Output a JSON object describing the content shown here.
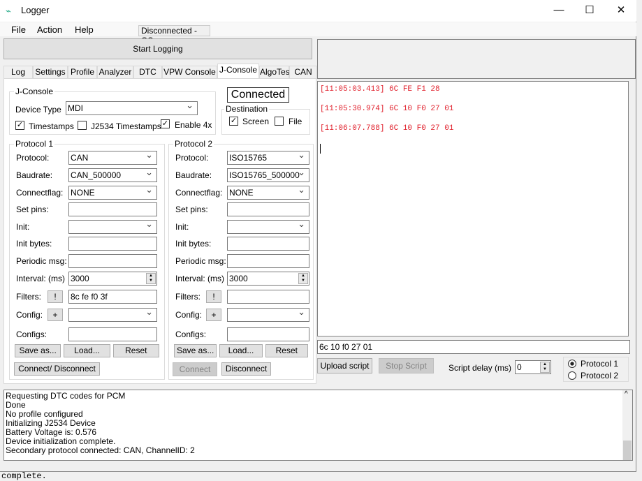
{
  "window": {
    "title": "Logger",
    "minimize": "—",
    "maximize": "☐",
    "close": "✕"
  },
  "menu": {
    "items": [
      "File",
      "Action",
      "Help"
    ],
    "status": "Disconnected - OS:"
  },
  "start_logging": "Start Logging",
  "tabs": [
    "Log",
    "Settings",
    "Profile",
    "Analyzer",
    "DTC",
    "VPW Console",
    "J-Console",
    "AlgoTest",
    "CAN"
  ],
  "selected_tab": "J-Console",
  "jconsole": {
    "group": "J-Console",
    "device_type_label": "Device Type",
    "device_type": "MDI",
    "timestamps": {
      "label": "Timestamps",
      "checked": true
    },
    "j2534_timestamps": {
      "label": "J2534 Timestamps",
      "checked": false
    },
    "enable4x": {
      "label": "Enable 4x",
      "checked": true
    }
  },
  "connection_status": "Connected",
  "destination": {
    "label": "Destination",
    "screen": {
      "label": "Screen",
      "checked": true
    },
    "file": {
      "label": "File",
      "checked": false
    }
  },
  "labels": {
    "protocol": "Protocol:",
    "baudrate": "Baudrate:",
    "connectflag": "Connectflag:",
    "set_pins": "Set pins:",
    "init": "Init:",
    "init_bytes": "Init bytes:",
    "periodic_msg": "Periodic msg:",
    "interval": "Interval: (ms)",
    "filters": "Filters:",
    "config": "Config:",
    "configs": "Configs:",
    "filter_btn": "!",
    "config_btn": "+",
    "save_as": "Save as...",
    "load": "Load...",
    "reset": "Reset"
  },
  "protocol1": {
    "title": "Protocol 1",
    "protocol": "CAN",
    "baudrate": "CAN_500000",
    "connectflag": "NONE",
    "set_pins": "",
    "init": "",
    "init_bytes": "",
    "periodic_msg": "",
    "interval": "3000",
    "filters": "8c fe f0 3f",
    "config": "",
    "configs": "",
    "connect_disconnect": "Connect/ Disconnect"
  },
  "protocol2": {
    "title": "Protocol 2",
    "protocol": "ISO15765",
    "baudrate": "ISO15765_500000",
    "connectflag": "NONE",
    "set_pins": "",
    "init": "",
    "init_bytes": "",
    "periodic_msg": "",
    "interval": "3000",
    "filters": "",
    "config": "",
    "configs": "",
    "connect": "Connect",
    "disconnect": "Disconnect"
  },
  "console_lines": [
    "[11:05:03.413] 6C FE F1 28",
    "[11:05:30.974] 6C 10 F0 27 01",
    "[11:06:07.788] 6C 10 F0 27 01"
  ],
  "command_input": "6c 10 f0 27 01",
  "script": {
    "upload": "Upload script",
    "stop": "Stop Script",
    "delay_label": "Script delay (ms)",
    "delay": "0"
  },
  "target": {
    "protocol1": "Protocol 1",
    "protocol2": "Protocol 2",
    "selected": "Protocol 1"
  },
  "log_lines": [
    "Requesting DTC codes for PCM",
    "Done",
    "No profile configured",
    "Initializing J2534 Device",
    "Battery Voltage is: 0.576",
    "Device initialization complete.",
    "Secondary protocol connected: CAN, ChannelID: 2"
  ],
  "background_text": "complete.",
  "colors": {
    "console_text": "#e0202c"
  }
}
